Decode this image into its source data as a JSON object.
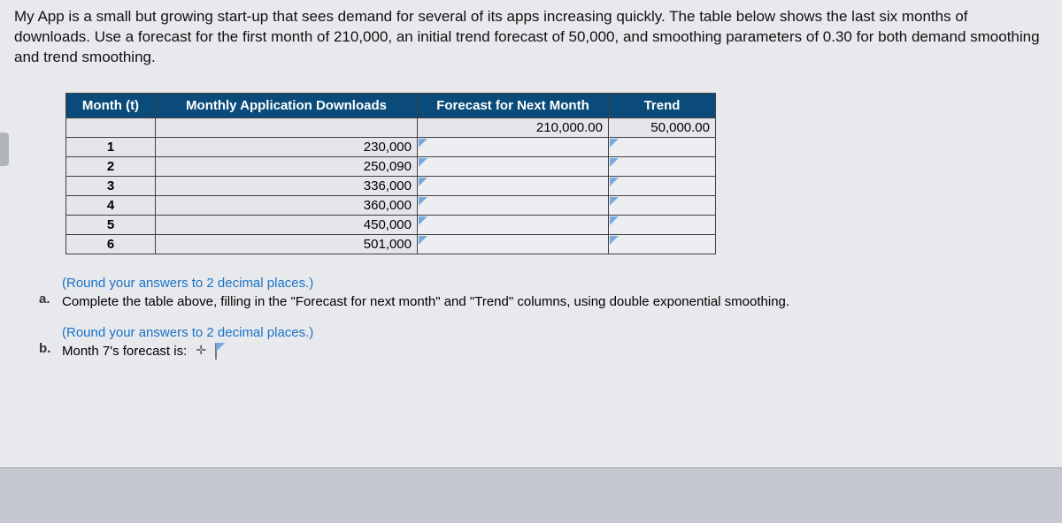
{
  "problem": {
    "paragraph": "My App is a small but growing start-up that sees demand for several of its apps increasing quickly. The table below shows the last six months of downloads. Use a forecast for the first month of 210,000, an initial trend forecast of 50,000, and smoothing parameters of 0.30 for both demand smoothing and trend smoothing."
  },
  "table": {
    "headers": {
      "month": "Month (t)",
      "downloads": "Monthly Application Downloads",
      "forecast": "Forecast for Next Month",
      "trend": "Trend"
    },
    "initial": {
      "forecast": "210,000.00",
      "trend": "50,000.00"
    },
    "rows": [
      {
        "month": "1",
        "downloads": "230,000"
      },
      {
        "month": "2",
        "downloads": "250,090"
      },
      {
        "month": "3",
        "downloads": "336,000"
      },
      {
        "month": "4",
        "downloads": "360,000"
      },
      {
        "month": "5",
        "downloads": "450,000"
      },
      {
        "month": "6",
        "downloads": "501,000"
      }
    ]
  },
  "parts": {
    "round_note": "(Round your answers to 2 decimal places.)",
    "a": {
      "label": "a.",
      "text": "Complete the table above, filling in the \"Forecast for next month\" and \"Trend\" columns, using double exponential smoothing."
    },
    "b": {
      "label": "b.",
      "text": "Month 7's forecast is:"
    }
  }
}
